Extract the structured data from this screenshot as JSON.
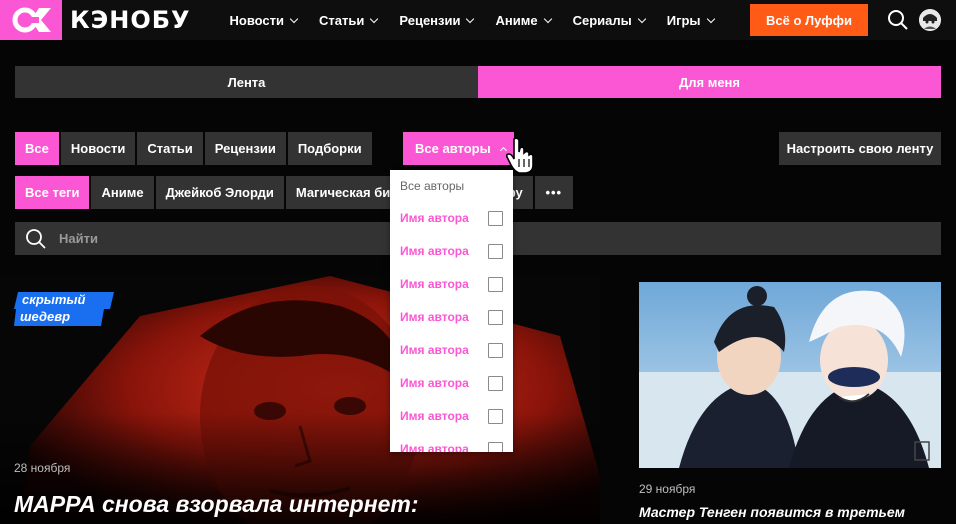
{
  "header": {
    "logo_text": "КЭНОБУ",
    "nav": [
      {
        "label": "Новости"
      },
      {
        "label": "Статьи"
      },
      {
        "label": "Рецензии"
      },
      {
        "label": "Аниме"
      },
      {
        "label": "Сериалы"
      },
      {
        "label": "Игры"
      }
    ],
    "cta_label": "Всё о Луффи"
  },
  "tabs": {
    "feed": "Лента",
    "for_me": "Для меня",
    "active": "for_me"
  },
  "filters": {
    "types": [
      "Все",
      "Новости",
      "Статьи",
      "Рецензии",
      "Подборки"
    ],
    "authors_label": "Все авторы",
    "customize_label": "Настроить свою ленту",
    "tags": [
      "Все теги",
      "Аниме",
      "Джейкоб Элорди",
      "Магическая битва",
      "Годжо Сатору"
    ],
    "more_label": "•••"
  },
  "search": {
    "placeholder": "Найти"
  },
  "dropdown": {
    "header": "Все авторы",
    "items": [
      "Имя автора",
      "Имя автора",
      "Имя автора",
      "Имя автора",
      "Имя автора",
      "Имя автора",
      "Имя автора",
      "Имя автора"
    ]
  },
  "hero": {
    "badge_line1": "скрытый",
    "badge_line2": "шедевр",
    "date": "28 ноября",
    "title": "МАРРА снова взорвала интернет:"
  },
  "side_article": {
    "date": "29 ноября",
    "title": "Мастер Тенген появится в третьем"
  },
  "colors": {
    "accent": "#fb57d4",
    "cta": "#ff5a16",
    "chip": "#333333",
    "bg": "#050505"
  }
}
